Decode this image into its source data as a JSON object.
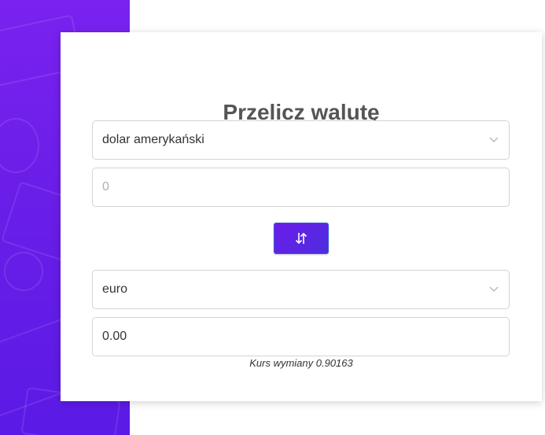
{
  "converter": {
    "title": "Przelicz walutę",
    "from_currency": "dolar amerykański",
    "from_amount_placeholder": "0",
    "to_currency": "euro",
    "to_amount": "0.00",
    "rate_text": "Kurs wymiany 0.90163",
    "swap_icon": "swap-vertical-arrows-icon"
  },
  "colors": {
    "accent": "#6a1ee8",
    "panel": "#7a22f0",
    "title": "#555555",
    "border": "#d3d3d3"
  }
}
